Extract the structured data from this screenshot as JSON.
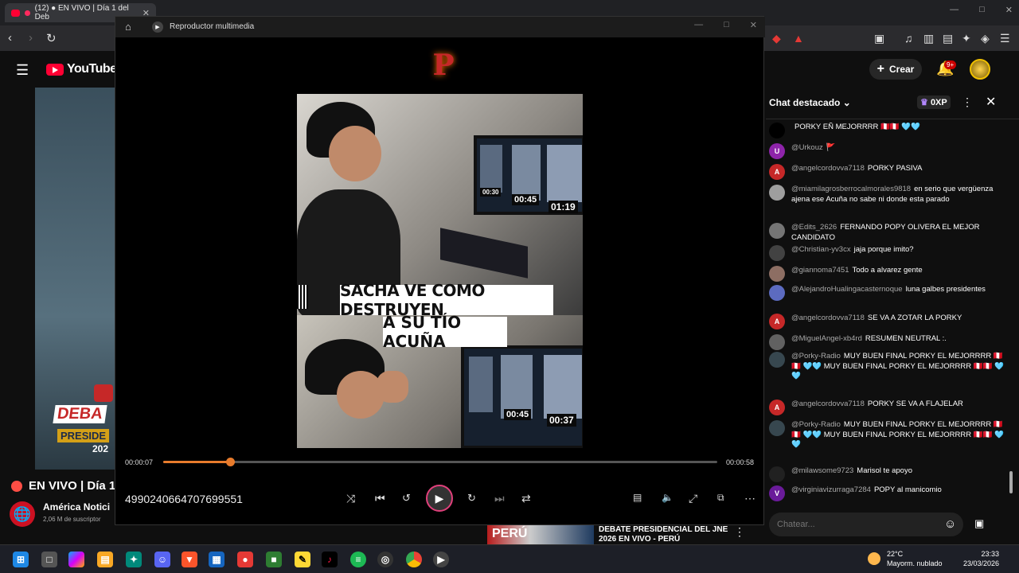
{
  "browser": {
    "tab_title": "(12) ● EN VIVO | Día 1 del Deb",
    "tab_close": "✕",
    "window_controls": [
      "—",
      "□",
      "✕"
    ]
  },
  "youtube": {
    "logo_text": "YouTube",
    "create_label": "Crear",
    "notifications_badge": "9+",
    "live_title": "EN VIVO | Día 1",
    "channel_name": "América Notici",
    "channel_subs": "2,06 M de suscriptor"
  },
  "player": {
    "window_title": "Reproductor multimedia",
    "current_time": "00:00:07",
    "duration": "00:00:58",
    "progress_fraction": 0.12,
    "file_name": "4990240664707699551",
    "caption_line1": "SACHA VE COMO DESTRUYEN",
    "caption_line2": "A SU TÍO ACUÑA",
    "clock_a1": "00:30",
    "clock_a2": "00:45",
    "clock_a3": "01:19",
    "clock_b1": "00:45",
    "clock_b2": "00:37",
    "logo_letter": "P"
  },
  "chat": {
    "title": "Chat destacado",
    "xp_badge": "0XP",
    "input_placeholder": "Chatear...",
    "messages": [
      {
        "user": "",
        "text": "PORKY EÑ MEJORRRR 🇵🇪🇵🇪 🩵🩵",
        "avatar": "",
        "avatar_color": "#000000"
      },
      {
        "user": "@Urkouz",
        "text": "🚩",
        "avatar": "U",
        "avatar_color": "#8e24aa"
      },
      {
        "user": "@angelcordovva7118",
        "text": "PORKY PASIVA",
        "avatar": "A",
        "avatar_color": "#c62828"
      },
      {
        "user": "@miamilagrosberrocalmorales9818",
        "text": "en serio que vergüenza ajena ese Acuña no sabe ni donde esta parado",
        "avatar": "",
        "avatar_color": "#9e9e9e"
      },
      {
        "user": "@Edits_2626",
        "text": "FERNANDO POPY OLIVERA EL MEJOR CANDIDATO",
        "avatar": "",
        "avatar_color": "#757575"
      },
      {
        "user": "@Christian-yv3cx",
        "text": "jaja porque imito?",
        "avatar": "",
        "avatar_color": "#424242"
      },
      {
        "user": "@giannoma7451",
        "text": "Todo a alvarez gente",
        "avatar": "",
        "avatar_color": "#8d6e63"
      },
      {
        "user": "@AlejandroHualingacasternoque",
        "text": "luna galbes presidentes",
        "avatar": "",
        "avatar_color": "#5c6bc0"
      },
      {
        "user": "@angelcordovva7118",
        "text": "SE VA A ZOTAR LA PORKY",
        "avatar": "A",
        "avatar_color": "#c62828"
      },
      {
        "user": "@MiguelAngel-xb4rd",
        "text": "RESUMEN NEUTRAL :.",
        "avatar": "",
        "avatar_color": "#616161"
      },
      {
        "user": "@Porky-Radio",
        "text": "MUY BUEN FINAL PORKY EL MEJORRRR 🇵🇪🇵🇪 🩵🩵 MUY BUEN FINAL PORKY EL MEJORRRR 🇵🇪🇵🇪 🩵🩵",
        "avatar": "",
        "avatar_color": "#37474f"
      },
      {
        "user": "@angelcordovva7118",
        "text": "PORKY SE VA A FLAJELAR",
        "avatar": "A",
        "avatar_color": "#c62828"
      },
      {
        "user": "@Porky-Radio",
        "text": "MUY BUEN FINAL PORKY EL MEJORRRR 🇵🇪🇵🇪 🩵🩵 MUY BUEN FINAL PORKY EL MEJORRRR 🇵🇪🇵🇪 🩵🩵",
        "avatar": "",
        "avatar_color": "#37474f"
      },
      {
        "user": "@milawsome9723",
        "text": "Marisol te apoyo",
        "avatar": "",
        "avatar_color": "#212121"
      },
      {
        "user": "@virginiavizurraga7284",
        "text": "POPY al manicomio",
        "avatar": "V",
        "avatar_color": "#6a1b9a"
      }
    ]
  },
  "recommendation": {
    "title": "DEBATE PRESIDENCIAL DEL JNE 2026 EN VIVO - PERÚ",
    "thumb_text": "PERÚ"
  },
  "taskbar": {
    "temperature": "22°C",
    "weather": "Mayorm. nublado",
    "time": "23:33",
    "date": "23/03/2026"
  },
  "debate_badge": {
    "line1": "DEBA",
    "line2": "PRESIDE",
    "line3": "202"
  },
  "colors": {
    "accent": "#e87b2c",
    "youtube_red": "#ff0033"
  }
}
